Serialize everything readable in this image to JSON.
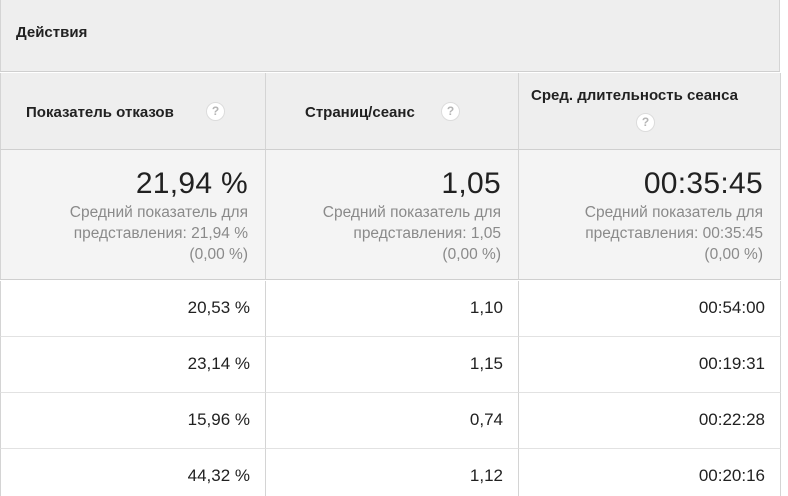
{
  "group": {
    "title": "Действия"
  },
  "columns": [
    {
      "label": "Показатель отказов",
      "help": "?"
    },
    {
      "label": "Страниц/сеанс",
      "help": "?"
    },
    {
      "label": "Сред. длительность сеанса",
      "help": "?"
    }
  ],
  "summary": [
    {
      "value": "21,94 %",
      "note_line1": "Средний показатель для",
      "note_line2": "представления: 21,94 %",
      "note_line3": "(0,00 %)"
    },
    {
      "value": "1,05",
      "note_line1": "Средний показатель для",
      "note_line2": "представления: 1,05",
      "note_line3": "(0,00 %)"
    },
    {
      "value": "00:35:45",
      "note_line1": "Средний показатель для",
      "note_line2": "представления: 00:35:45",
      "note_line3": "(0,00 %)"
    }
  ],
  "rows": [
    [
      "20,53 %",
      "1,10",
      "00:54:00"
    ],
    [
      "23,14 %",
      "1,15",
      "00:19:31"
    ],
    [
      "15,96 %",
      "0,74",
      "00:22:28"
    ],
    [
      "44,32 %",
      "1,12",
      "00:20:16"
    ]
  ]
}
